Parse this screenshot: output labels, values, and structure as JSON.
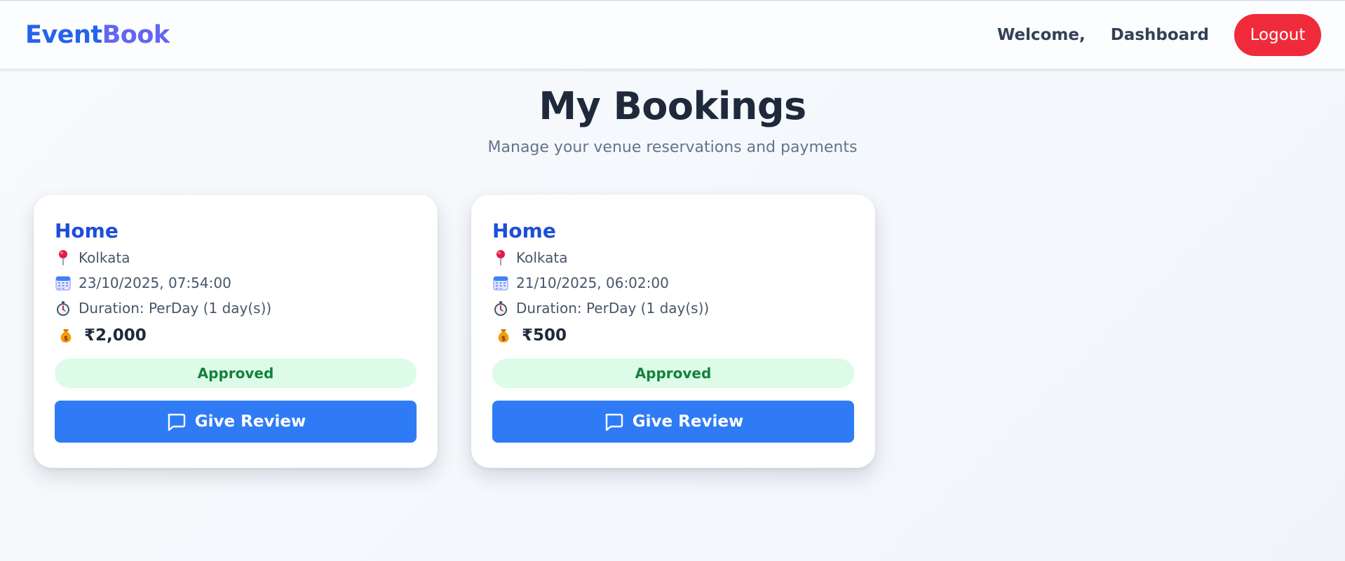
{
  "header": {
    "brand_part1": "Event",
    "brand_part2": "Book",
    "welcome": "Welcome,",
    "dashboard": "Dashboard",
    "logout": "Logout"
  },
  "page": {
    "title": "My Bookings",
    "subtitle": "Manage your venue reservations and payments"
  },
  "bookings": [
    {
      "venue": "Home",
      "location": "Kolkata",
      "datetime": "23/10/2025, 07:54:00",
      "duration": "Duration: PerDay (1 day(s))",
      "price": "₹2,000",
      "status": "Approved",
      "review_label": "Give Review"
    },
    {
      "venue": "Home",
      "location": "Kolkata",
      "datetime": "21/10/2025, 06:02:00",
      "duration": "Duration: PerDay (1 day(s))",
      "price": "₹500",
      "status": "Approved",
      "review_label": "Give Review"
    }
  ],
  "icons": {
    "location": "pushpin-icon",
    "date": "calendar-icon",
    "duration": "stopwatch-icon",
    "price": "money-bag-icon",
    "review": "chat-bubble-icon"
  },
  "colors": {
    "brand_primary": "#2563eb",
    "brand_secondary": "#6366f1",
    "logout": "#ef2b3b",
    "review_button": "#2f7bf5",
    "status_bg": "#dcfce7",
    "status_text": "#15803d"
  }
}
